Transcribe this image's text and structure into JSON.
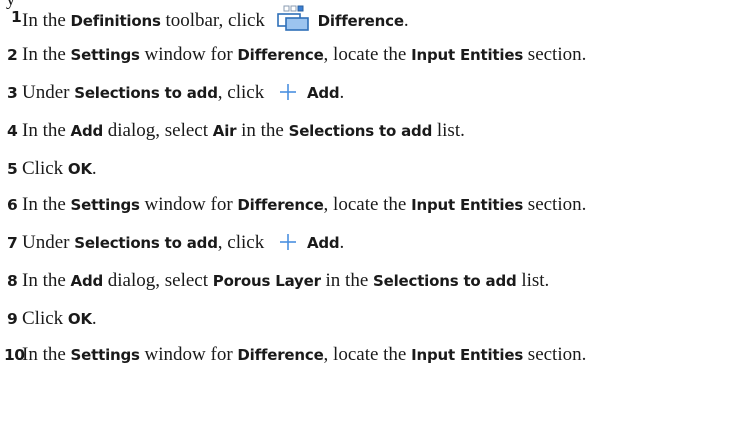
{
  "doc": {
    "top_fragment": "y",
    "steps": [
      {
        "num": "1",
        "parts": [
          {
            "t": "In the ",
            "b": false
          },
          {
            "t": "Definitions",
            "b": true
          },
          {
            "t": " toolbar, click ",
            "b": false
          },
          {
            "icon": "difference-toolbar-icon"
          },
          {
            "t": "Difference",
            "b": true
          },
          {
            "t": ".",
            "b": false
          }
        ]
      },
      {
        "num": "2",
        "parts": [
          {
            "t": "In the ",
            "b": false
          },
          {
            "t": "Settings",
            "b": true
          },
          {
            "t": " window for ",
            "b": false
          },
          {
            "t": "Difference",
            "b": true
          },
          {
            "t": ", locate the ",
            "b": false
          },
          {
            "t": "Input Entities",
            "b": true
          },
          {
            "t": " section.",
            "b": false
          }
        ]
      },
      {
        "num": "3",
        "parts": [
          {
            "t": "Under ",
            "b": false
          },
          {
            "t": "Selections to add",
            "b": true
          },
          {
            "t": ", click ",
            "b": false
          },
          {
            "icon": "plus-icon"
          },
          {
            "t": "Add",
            "b": true
          },
          {
            "t": ".",
            "b": false
          }
        ]
      },
      {
        "num": "4",
        "parts": [
          {
            "t": "In the ",
            "b": false
          },
          {
            "t": "Add",
            "b": true
          },
          {
            "t": " dialog, select ",
            "b": false
          },
          {
            "t": "Air",
            "b": true
          },
          {
            "t": " in the ",
            "b": false
          },
          {
            "t": "Selections to add",
            "b": true
          },
          {
            "t": " list.",
            "b": false
          }
        ]
      },
      {
        "num": "5",
        "parts": [
          {
            "t": "Click ",
            "b": false
          },
          {
            "t": "OK",
            "b": true
          },
          {
            "t": ".",
            "b": false
          }
        ]
      },
      {
        "num": "6",
        "parts": [
          {
            "t": "In the ",
            "b": false
          },
          {
            "t": "Settings",
            "b": true
          },
          {
            "t": " window for ",
            "b": false
          },
          {
            "t": "Difference",
            "b": true
          },
          {
            "t": ", locate the ",
            "b": false
          },
          {
            "t": "Input Entities",
            "b": true
          },
          {
            "t": " section.",
            "b": false
          }
        ]
      },
      {
        "num": "7",
        "parts": [
          {
            "t": "Under ",
            "b": false
          },
          {
            "t": "Selections to add",
            "b": true
          },
          {
            "t": ", click ",
            "b": false
          },
          {
            "icon": "plus-icon"
          },
          {
            "t": "Add",
            "b": true
          },
          {
            "t": ".",
            "b": false
          }
        ]
      },
      {
        "num": "8",
        "parts": [
          {
            "t": "In the ",
            "b": false
          },
          {
            "t": "Add",
            "b": true
          },
          {
            "t": " dialog, select ",
            "b": false
          },
          {
            "t": "Porous Layer",
            "b": true
          },
          {
            "t": " in the ",
            "b": false
          },
          {
            "t": "Selections to add",
            "b": true
          },
          {
            "t": " list.",
            "b": false
          }
        ]
      },
      {
        "num": "9",
        "parts": [
          {
            "t": "Click ",
            "b": false
          },
          {
            "t": "OK",
            "b": true
          },
          {
            "t": ".",
            "b": false
          }
        ]
      },
      {
        "num": "10",
        "parts": [
          {
            "t": "In the ",
            "b": false
          },
          {
            "t": "Settings",
            "b": true
          },
          {
            "t": " window for ",
            "b": false
          },
          {
            "t": "Difference",
            "b": true
          },
          {
            "t": ", locate the ",
            "b": false
          },
          {
            "t": "Input Entities",
            "b": true
          },
          {
            "t": " section.",
            "b": false
          }
        ]
      }
    ]
  }
}
